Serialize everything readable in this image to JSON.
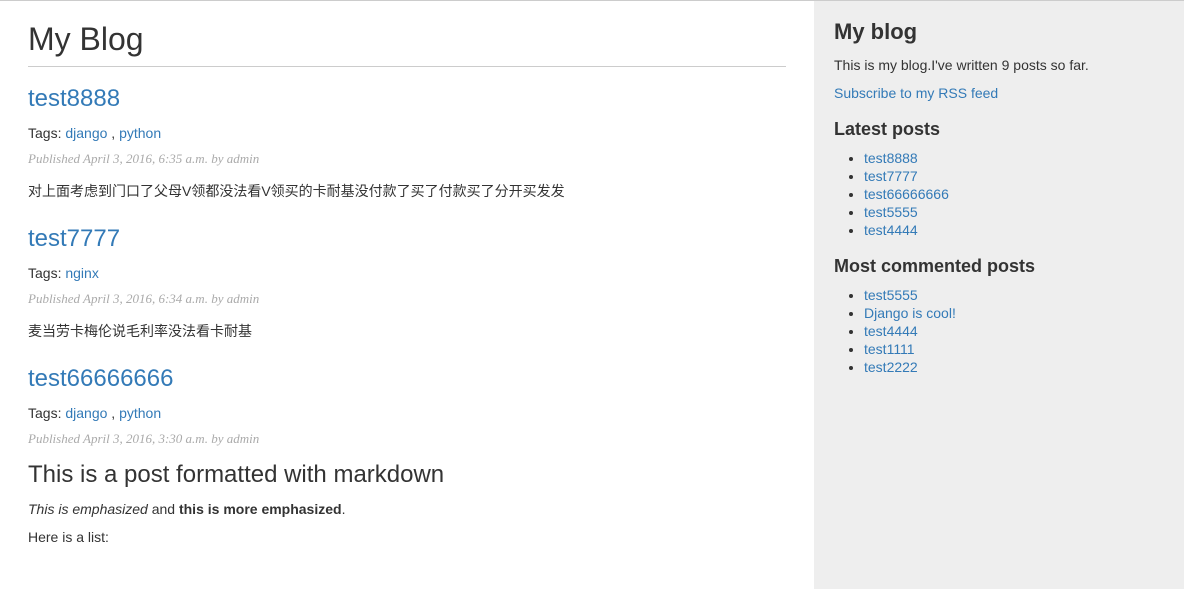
{
  "page_title": "My Blog",
  "posts": [
    {
      "title": "test8888",
      "tags_label": "Tags:",
      "tags": [
        "django",
        "python"
      ],
      "meta": "Published April 3, 2016, 6:35 a.m. by admin",
      "body": "对上面考虑到门口了父母V领都没法看V领买的卡耐基没付款了买了付款买了分开买发发"
    },
    {
      "title": "test7777",
      "tags_label": "Tags:",
      "tags": [
        "nginx"
      ],
      "meta": "Published April 3, 2016, 6:34 a.m. by admin",
      "body": "麦当劳卡梅伦说毛利率没法看卡耐基"
    },
    {
      "title": "test66666666",
      "tags_label": "Tags:",
      "tags": [
        "django",
        "python"
      ],
      "meta": "Published April 3, 2016, 3:30 a.m. by admin",
      "md_heading": "This is a post formatted with markdown",
      "md_em": "This is emphasized",
      "md_mid": " and ",
      "md_strong": "this is more emphasized",
      "md_tail": ".",
      "md_list_intro": "Here is a list:"
    }
  ],
  "sidebar": {
    "title": "My blog",
    "intro": "This is my blog.I've written 9 posts so far.",
    "rss_label": "Subscribe to my RSS feed",
    "latest_heading": "Latest posts",
    "latest": [
      "test8888",
      "test7777",
      "test66666666",
      "test5555",
      "test4444"
    ],
    "commented_heading": "Most commented posts",
    "commented": [
      "test5555",
      "Django is cool!",
      "test4444",
      "test1111",
      "test2222"
    ]
  }
}
